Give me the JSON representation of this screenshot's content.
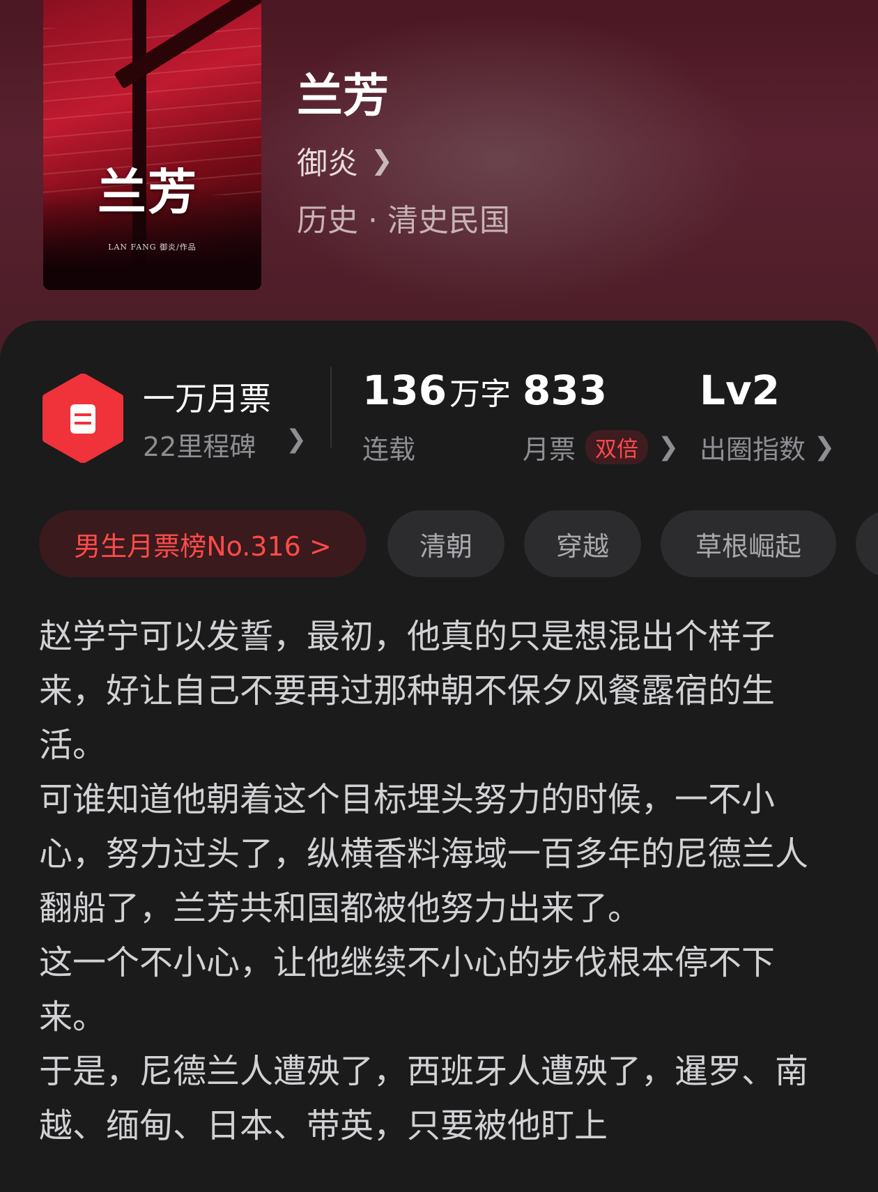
{
  "book": {
    "title": "兰芳",
    "author": "御炎",
    "category": "历史 · 清史民国",
    "cover": {
      "title_text": "兰芳",
      "byline": "LAN FANG 御炎/作品"
    }
  },
  "stats": {
    "badge": {
      "main": "一万月票",
      "sub": "22里程碑"
    },
    "words": {
      "number": "136",
      "unit": "万字",
      "label": "连载"
    },
    "tickets": {
      "number": "833",
      "label": "月票",
      "tag": "双倍"
    },
    "index": {
      "number": "Lv2",
      "label": "出圈指数"
    }
  },
  "tags": {
    "rank": "男生月票榜No.316 >",
    "items": [
      "清朝",
      "穿越",
      "草根崛起"
    ]
  },
  "description": {
    "paragraphs": [
      "赵学宁可以发誓，最初，他真的只是想混出个样子来，好让自己不要再过那种朝不保夕风餐露宿的生活。",
      "可谁知道他朝着这个目标埋头努力的时候，一不小心，努力过头了，纵横香料海域一百多年的尼德兰人翻船了，兰芳共和国都被他努力出来了。",
      "这一个不小心，让他继续不小心的步伐根本停不下来。",
      "于是，尼德兰人遭殃了，西班牙人遭殃了，暹罗、南越、缅甸、日本、带英，只要被他盯上"
    ]
  },
  "colors": {
    "accent_red": "#ff4b4b",
    "panel_bg": "#1b1b1c",
    "hero_bg": "#4a1722"
  },
  "icons": {
    "badge": "ticket-hexagon-icon",
    "chevron": "chevron-right-icon"
  }
}
